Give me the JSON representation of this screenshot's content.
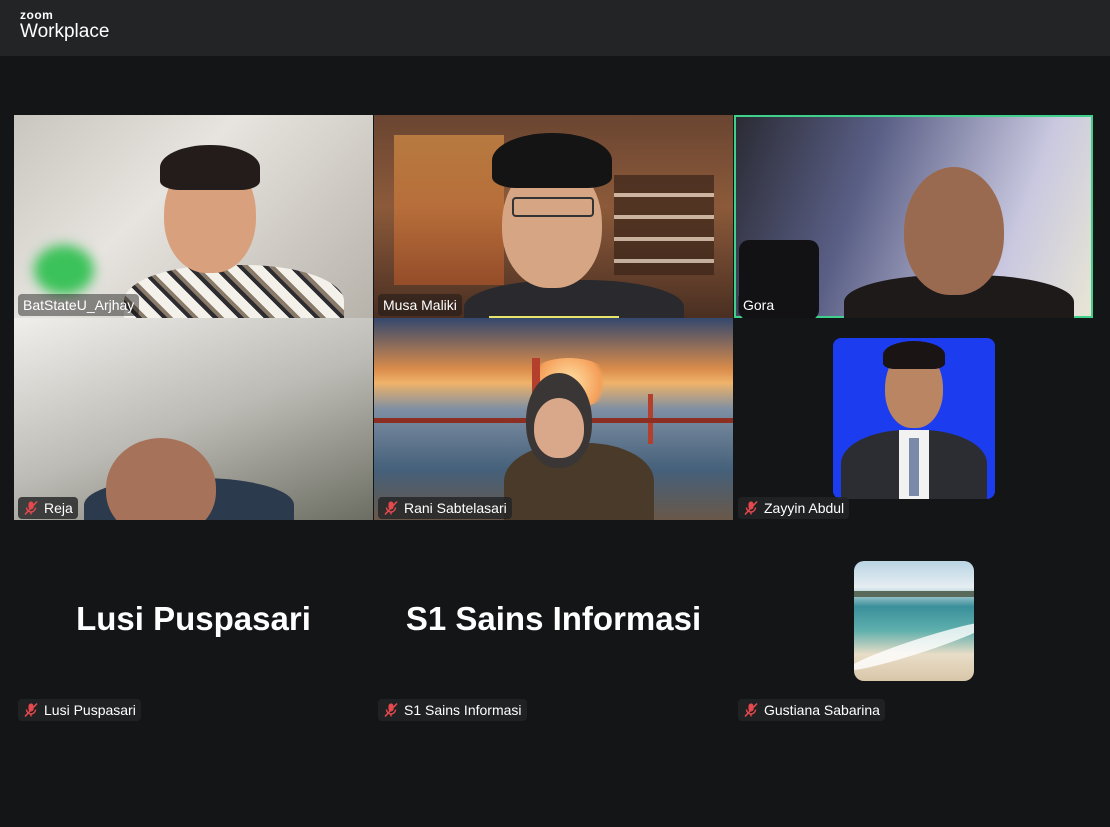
{
  "app": {
    "brand_small": "zoom",
    "brand_large": "Workplace"
  },
  "participants": [
    {
      "name": "BatStateU_Arjhay",
      "muted": false,
      "video": true
    },
    {
      "name": "Musa Maliki",
      "muted": false,
      "video": true
    },
    {
      "name": "Gora",
      "muted": false,
      "video": true,
      "active_speaker": true
    },
    {
      "name": "Reja",
      "muted": true,
      "video": true
    },
    {
      "name": "Rani Sabtelasari",
      "muted": true,
      "video": true
    },
    {
      "name": "Zayyin Abdul",
      "muted": true,
      "video": false,
      "avatar": "profile-photo"
    },
    {
      "name": "Lusi Puspasari",
      "muted": true,
      "video": false,
      "display_text": "Lusi Puspasari"
    },
    {
      "name": "S1 Sains Informasi",
      "muted": true,
      "video": false,
      "display_text": "S1 Sains Informasi"
    },
    {
      "name": "Gustiana Sabarina",
      "muted": true,
      "video": false,
      "avatar": "beach-photo"
    }
  ],
  "colors": {
    "active_speaker_border": "#3fd18b",
    "muted_icon": "#e5484d",
    "background": "#141516"
  }
}
